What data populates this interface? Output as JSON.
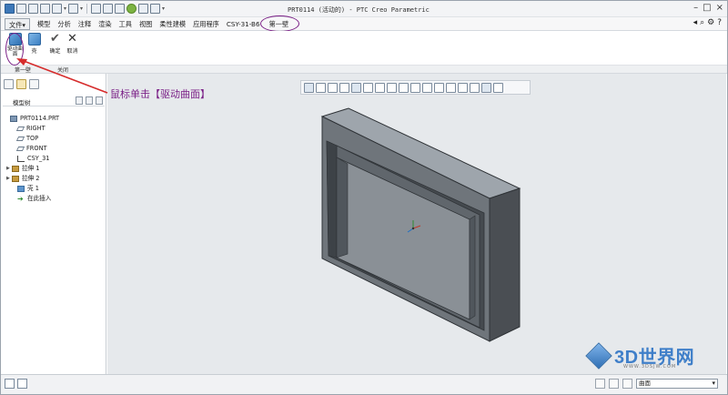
{
  "window": {
    "title": "PRT0114 (活动的) - PTC Creo Parametric"
  },
  "menu": {
    "tabs": [
      {
        "label": "文件▾"
      },
      {
        "label": "模型"
      },
      {
        "label": "分析"
      },
      {
        "label": "注释"
      },
      {
        "label": "渲染"
      },
      {
        "label": "工具"
      },
      {
        "label": "视图"
      },
      {
        "label": "柔性建模"
      },
      {
        "label": "应用程序"
      },
      {
        "label": "CSY-31-B6"
      },
      {
        "label": "第一壁"
      }
    ],
    "active_tab": "第一壁"
  },
  "ribbon": {
    "drive_surface": "驱动曲面",
    "shell": "壳",
    "confirm": "确定",
    "cancel": "取消",
    "group_wall": "第一壁",
    "group_close": "关闭"
  },
  "annotation": {
    "text": "鼠标单击【驱动曲面】",
    "color": "#7a1f86"
  },
  "model_tree": {
    "header": "模型树",
    "items": [
      {
        "label": "PRT0114.PRT",
        "icon": "part-icon",
        "indent": 0,
        "twisty": ""
      },
      {
        "label": "RIGHT",
        "icon": "plane-icon",
        "indent": 1,
        "twisty": ""
      },
      {
        "label": "TOP",
        "icon": "plane-icon",
        "indent": 1,
        "twisty": ""
      },
      {
        "label": "FRONT",
        "icon": "plane-icon",
        "indent": 1,
        "twisty": ""
      },
      {
        "label": "CSY_31",
        "icon": "csys-icon",
        "indent": 1,
        "twisty": ""
      },
      {
        "label": "拉伸 1",
        "icon": "extrude-icon",
        "indent": 1,
        "twisty": "▶"
      },
      {
        "label": "拉伸 2",
        "icon": "extrude-icon",
        "indent": 1,
        "twisty": "▶"
      },
      {
        "label": "壳 1",
        "icon": "shell-icon",
        "indent": 1,
        "twisty": ""
      },
      {
        "label": "在此插入",
        "icon": "insert-icon",
        "indent": 1,
        "twisty": ""
      }
    ]
  },
  "statusbar": {
    "filter_value": "曲面"
  },
  "watermark": {
    "text": "3D世界网",
    "subtext": "WWW.3DSJW.COM"
  }
}
